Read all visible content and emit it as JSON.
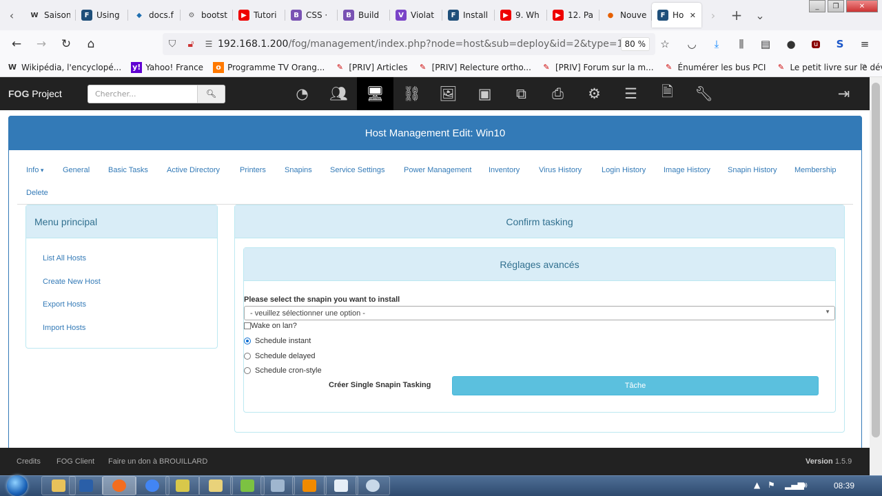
{
  "browser": {
    "tabs": [
      {
        "label": "Saison",
        "icon": "wikipedia-icon"
      },
      {
        "label": "Using",
        "icon": "fog-icon"
      },
      {
        "label": "docs.f",
        "icon": "docs-icon"
      },
      {
        "label": "bootst",
        "icon": "gear-icon"
      },
      {
        "label": "Tutori",
        "icon": "youtube-icon"
      },
      {
        "label": "CSS · ",
        "icon": "bootstrap-icon"
      },
      {
        "label": "Build ",
        "icon": "bootstrap-icon"
      },
      {
        "label": "Violat",
        "icon": "visualstudio-icon"
      },
      {
        "label": "Install",
        "icon": "fog-icon"
      },
      {
        "label": "9. Wh",
        "icon": "youtube-icon"
      },
      {
        "label": "12. Pa",
        "icon": "youtube-icon"
      },
      {
        "label": "Nouve",
        "icon": "firefox-icon"
      },
      {
        "label": "Ho",
        "icon": "fog-icon",
        "active": true
      }
    ],
    "url_host": "192.168.1.200",
    "url_path": "/fog/management/index.php?node=host&sub=deploy&id=2&type=13",
    "zoom": "80 %",
    "bookmarks": [
      {
        "label": "Wikipédia, l'encyclopé...",
        "icon": "wikipedia-icon"
      },
      {
        "label": "Yahoo! France",
        "icon": "yahoo-icon"
      },
      {
        "label": "Programme TV Orang...",
        "icon": "orange-icon"
      },
      {
        "label": "[PRIV] Articles",
        "icon": "pen-icon"
      },
      {
        "label": "[PRIV] Relecture ortho...",
        "icon": "pen-icon"
      },
      {
        "label": "[PRIV] Forum sur la m...",
        "icon": "pen-icon"
      },
      {
        "label": "Énumérer les bus PCI",
        "icon": "pen-icon"
      },
      {
        "label": "Le petit livre sur le dév...",
        "icon": "pen-icon"
      }
    ]
  },
  "fog": {
    "brand_strong": "FOG",
    "brand_rest": " Project",
    "search_placeholder": "Chercher...",
    "page_title": "Host Management Edit: Win10",
    "tabs": [
      "Info",
      "General",
      "Basic Tasks",
      "Active Directory",
      "Printers",
      "Snapins",
      "Service Settings",
      "Power Management",
      "Inventory",
      "Virus History",
      "Login History",
      "Image History",
      "Snapin History",
      "Membership",
      "Delete"
    ],
    "menu_title": "Menu principal",
    "menu_items": [
      "List All Hosts",
      "Create New Host",
      "Export Hosts",
      "Import Hosts"
    ],
    "confirm_title": "Confirm tasking",
    "advanced_title": "Réglages avancés",
    "snapin_label": "Please select the snapin you want to install",
    "snapin_select": "- veuillez sélectionner une option -",
    "wol_label": "Wake on lan?",
    "schedule_options": [
      {
        "label": "Schedule instant",
        "selected": true
      },
      {
        "label": "Schedule delayed",
        "selected": false
      },
      {
        "label": "Schedule cron-style",
        "selected": false
      }
    ],
    "create_label": "Créer Single Snapin Tasking",
    "task_button": "Tâche",
    "footer_links": [
      "Credits",
      "FOG Client",
      "Faire un don à BROUILLARD"
    ],
    "version_label": "Version",
    "version_value": "1.5.9"
  },
  "taskbar": {
    "clock": "08:39"
  }
}
